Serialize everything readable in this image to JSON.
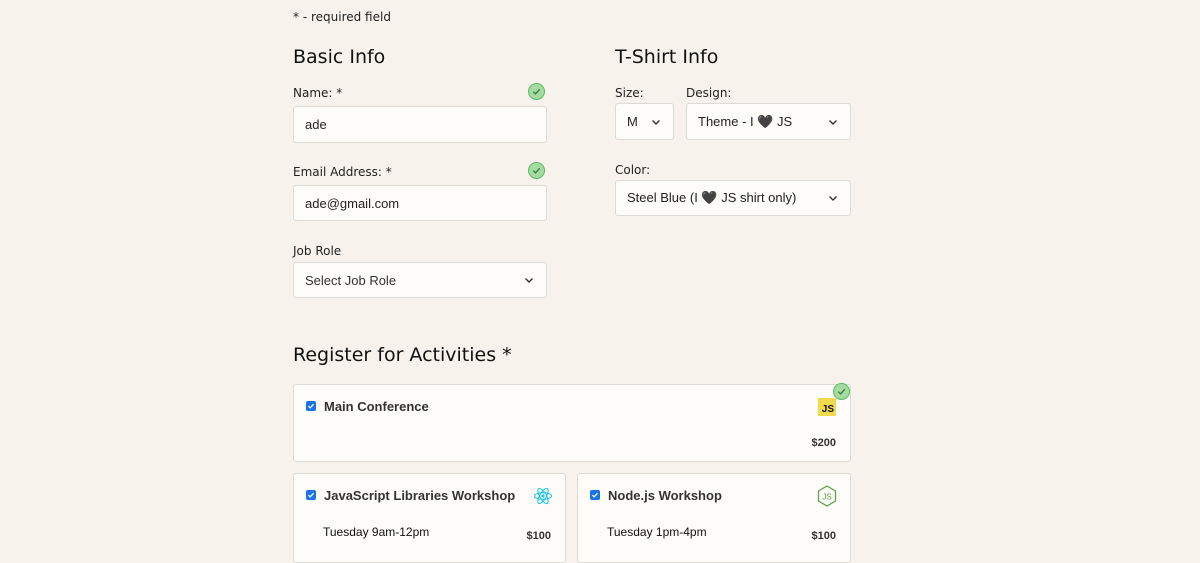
{
  "required_note": "* - required field",
  "basic_info": {
    "heading": "Basic Info",
    "name_label": "Name: *",
    "name_value": "ade",
    "email_label": "Email Address: *",
    "email_value": "ade@gmail.com",
    "job_role_label": "Job Role",
    "job_role_value": "Select Job Role"
  },
  "tshirt_info": {
    "heading": "T-Shirt Info",
    "size_label": "Size:",
    "size_value": "M",
    "design_label": "Design:",
    "design_value": "Theme - I 🖤 JS",
    "color_label": "Color:",
    "color_value": "Steel Blue (I 🖤 JS shirt only)"
  },
  "activities": {
    "heading": "Register for Activities *",
    "items": [
      {
        "title": "Main Conference",
        "time": "",
        "price": "$200",
        "checked": true,
        "icon": "js-logo-icon"
      },
      {
        "title": "JavaScript Libraries Workshop",
        "time": "Tuesday 9am-12pm",
        "price": "$100",
        "checked": true,
        "icon": "react-logo-icon"
      },
      {
        "title": "Node.js Workshop",
        "time": "Tuesday 1pm-4pm",
        "price": "$100",
        "checked": true,
        "icon": "nodejs-logo-icon"
      }
    ]
  },
  "colors": {
    "background": "#f7f3ec",
    "valid_green": "#a4dba0",
    "checkbox_blue": "#1a73e8",
    "js_yellow": "#f0db4f",
    "react_cyan": "#22c4e8",
    "node_green": "#5a9e4b"
  }
}
